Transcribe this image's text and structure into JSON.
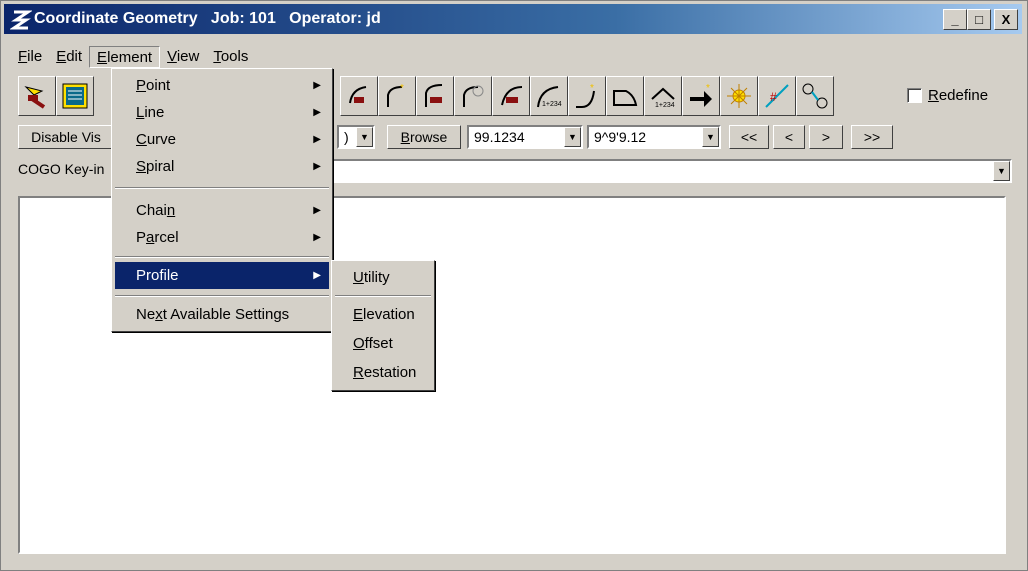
{
  "window": {
    "title": "Coordinate Geometry   Job: 101   Operator: jd",
    "minimize": "_",
    "maximize": "□",
    "close": "X"
  },
  "menubar": [
    {
      "label": "File",
      "key": "F",
      "rest": "ile"
    },
    {
      "label": "Edit",
      "key": "E",
      "rest": "dit"
    },
    {
      "label": "Element",
      "key": "E",
      "rest": "lement"
    },
    {
      "label": "View",
      "key": "V",
      "rest": "iew"
    },
    {
      "label": "Tools",
      "key": "T",
      "rest": "ools"
    }
  ],
  "toolbar": {
    "redefine_label": "Redefine",
    "redefine_checked": false,
    "icons": [
      "pointer-tool-icon",
      "store-tool-icon",
      "hidden-tool-icon",
      "arc-tool-icon",
      "line-traverse-icon",
      "curve-pick-icon",
      "curve-traverse-icon",
      "curve-pick2-icon",
      "station-curve-icon",
      "spiral-traverse-icon",
      "polygon-icon",
      "station-arc-icon",
      "arrow-icon",
      "star-icon",
      "intersect-icon",
      "chain-icon"
    ]
  },
  "row2": {
    "disable_vis_label": "Disable Vis",
    "browse_label": "Browse",
    "distance_value": "99.1234",
    "angle_value": "9^9'9.12",
    "nav_first": "<<",
    "nav_prev": "<",
    "nav_next": ">",
    "nav_last": ">>",
    "hidden_combo_value": ")"
  },
  "keyin": {
    "label": "COGO Key-in",
    "value": ""
  },
  "element_menu": [
    {
      "label": "Point",
      "key": "P",
      "rest": "oint",
      "arrow": true
    },
    {
      "label": "Line",
      "key": "L",
      "rest": "ine",
      "arrow": true
    },
    {
      "label": "Curve",
      "key": "C",
      "rest": "urve",
      "arrow": true
    },
    {
      "label": "Spiral",
      "key": "S",
      "rest": "piral",
      "arrow": true
    },
    {
      "label": "Chain",
      "pre": "Chai",
      "key": "n",
      "rest": "",
      "arrow": true
    },
    {
      "label": "Parcel",
      "pre": "P",
      "key": "a",
      "rest": "rcel",
      "arrow": true
    },
    {
      "label": "Profile",
      "arrow": true
    },
    {
      "label": "Next Available Settings",
      "pre": "Ne",
      "key": "x",
      "rest": "t Available Settings",
      "arrow": false
    }
  ],
  "profile_submenu": [
    {
      "label": "Utility",
      "key": "U",
      "rest": "tility"
    },
    {
      "label": "Elevation",
      "key": "E",
      "rest": "levation"
    },
    {
      "label": "Offset",
      "key": "O",
      "rest": "ffset"
    },
    {
      "label": "Restation",
      "key": "R",
      "rest": "estation"
    }
  ]
}
